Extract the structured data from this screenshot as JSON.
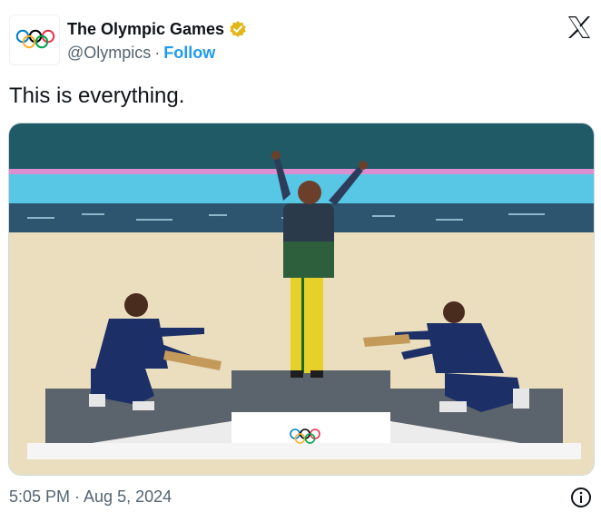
{
  "account": {
    "display_name": "The Olympic Games",
    "handle": "@Olympics",
    "separator": "·",
    "follow_label": "Follow",
    "verified_color": "#e2b719"
  },
  "tweet": {
    "text": "This is everything.",
    "timestamp": "5:05 PM · Aug 5, 2024"
  },
  "media": {
    "image_type": "photo"
  },
  "icons": {
    "brand": "x-logo-icon",
    "info": "info-icon",
    "avatar": "olympic-rings-icon",
    "badge": "verified-badge-icon"
  },
  "colors": {
    "link": "#1d9bf0",
    "secondary_text": "#536471",
    "ring_blue": "#0081c8",
    "ring_yellow": "#fcb131",
    "ring_black": "#000000",
    "ring_green": "#00a651",
    "ring_red": "#ee334e"
  }
}
